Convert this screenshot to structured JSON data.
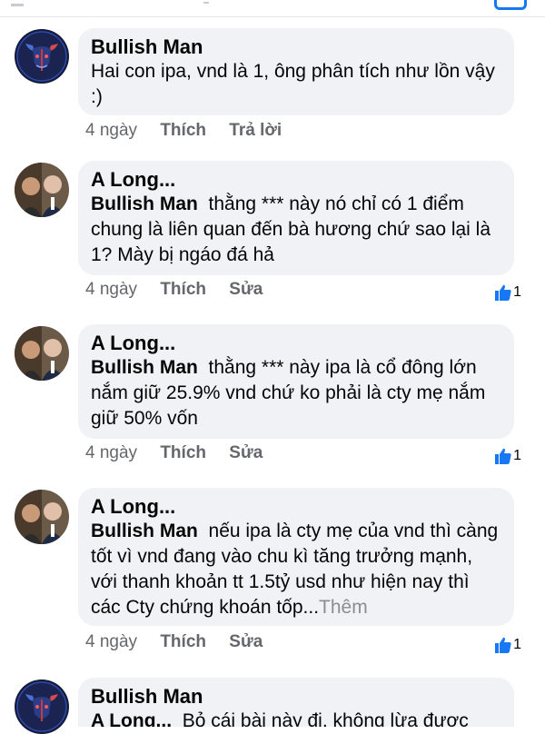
{
  "comments": [
    {
      "author": "Bullish Man",
      "text": "Hai con ipa, vnd là 1, ông phân tích như lồn vậy :)",
      "time": "4 ngày",
      "actions": [
        "Thích",
        "Trả lời"
      ]
    },
    {
      "author": "A Long...",
      "mention": "Bullish Man",
      "text": "thằng *** này nó chỉ có 1 điểm chung là liên quan đến bà hương chứ sao lại là 1? Mày bị ngáo đá hả",
      "time": "4 ngày",
      "actions": [
        "Thích",
        "Sửa"
      ],
      "reactions": "1"
    },
    {
      "author": "A Long...",
      "mention": "Bullish Man",
      "text": "thằng *** này ipa là cổ đông lớn nắm giữ 25.9% vnd chứ ko phải là cty mẹ nắm giữ 50% vốn",
      "time": "4 ngày",
      "actions": [
        "Thích",
        "Sửa"
      ],
      "reactions": "1"
    },
    {
      "author": "A Long...",
      "mention": "Bullish Man",
      "text": "nếu ipa là cty mẹ của vnd thì càng tốt vì vnd đang vào chu kì tăng trưởng mạnh, với thanh khoản tt 1.5tỷ usd như hiện nay thì các Cty chứng khoán tốp...",
      "more": "Thêm",
      "time": "4 ngày",
      "actions": [
        "Thích",
        "Sửa"
      ],
      "reactions": "1"
    },
    {
      "author": "Bullish Man",
      "mention": "A Long...",
      "text": "Bỏ cái bài này đi, không lừa được"
    }
  ],
  "colors": {
    "bubble": "#f0f2f5",
    "meta": "#65676b",
    "like_blue": "#1877f2"
  }
}
